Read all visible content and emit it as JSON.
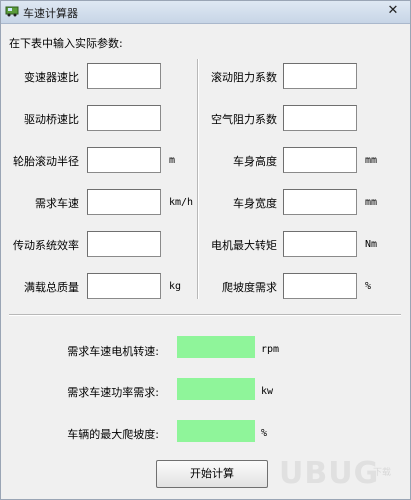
{
  "window": {
    "title": "车速计算器",
    "close_glyph": "✕"
  },
  "intro": "在下表中输入实际参数:",
  "left_params": [
    {
      "label": "变速器速比",
      "unit": ""
    },
    {
      "label": "驱动桥速比",
      "unit": ""
    },
    {
      "label": "轮胎滚动半径",
      "unit": "m"
    },
    {
      "label": "需求车速",
      "unit": "km/h"
    },
    {
      "label": "传动系统效率",
      "unit": ""
    },
    {
      "label": "满载总质量",
      "unit": "kg"
    }
  ],
  "right_params": [
    {
      "label": "滚动阻力系数",
      "unit": ""
    },
    {
      "label": "空气阻力系数",
      "unit": ""
    },
    {
      "label": "车身高度",
      "unit": "mm"
    },
    {
      "label": "车身宽度",
      "unit": "mm"
    },
    {
      "label": "电机最大转矩",
      "unit": "Nm"
    },
    {
      "label": "爬坡度需求",
      "unit": "%"
    }
  ],
  "results": [
    {
      "label": "需求车速电机转速:",
      "unit": "rpm"
    },
    {
      "label": "需求车速功率需求:",
      "unit": "kw"
    },
    {
      "label": "车辆的最大爬坡度:",
      "unit": "%"
    }
  ],
  "start_button": "开始计算",
  "watermark": {
    "text": "UBUG",
    "sub": "下载"
  },
  "colors": {
    "result_bg": "#8ff59a",
    "window_bg": "#f0f0f0"
  },
  "icons": {
    "app": "app-car-icon",
    "close": "close-icon"
  }
}
